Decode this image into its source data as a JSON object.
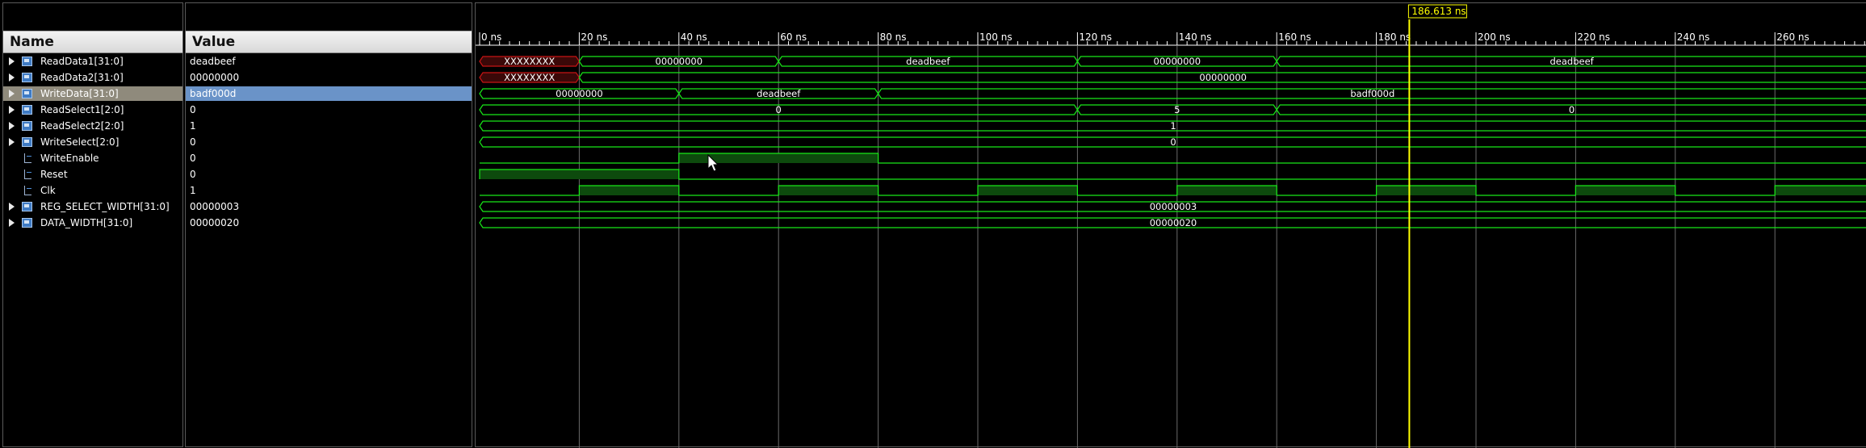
{
  "columns": {
    "name": "Name",
    "value": "Value"
  },
  "cursor": {
    "time_ns": 186.613,
    "label": "186.613 ns",
    "color": "#ffff00"
  },
  "timeline": {
    "start_ns": 0,
    "end_ns": 278.4,
    "major_step_ns": 20,
    "minor_step_ns": 2,
    "tick_labels": [
      "0 ns",
      "20 ns",
      "40 ns",
      "60 ns",
      "80 ns",
      "100 ns",
      "120 ns",
      "140 ns",
      "160 ns",
      "180 ns",
      "200 ns",
      "220 ns",
      "240 ns",
      "260 ns"
    ]
  },
  "colors": {
    "wave": "#18e818",
    "undefined": "#c81414",
    "high_fill": "#0d4a0d",
    "selected_name_bg": "#8f8a7c",
    "selected_value_bg": "#6a93c8"
  },
  "signals": [
    {
      "name": "ReadData1[31:0]",
      "value": "deadbeef",
      "kind": "bus",
      "segments": [
        {
          "start": 0,
          "end": 20,
          "label": "XXXXXXXX",
          "undef": true
        },
        {
          "start": 20,
          "end": 60,
          "label": "00000000"
        },
        {
          "start": 60,
          "end": 120,
          "label": "deadbeef"
        },
        {
          "start": 120,
          "end": 160,
          "label": "00000000"
        },
        {
          "start": 160,
          "end": 300,
          "label": "deadbeef"
        }
      ]
    },
    {
      "name": "ReadData2[31:0]",
      "value": "00000000",
      "kind": "bus",
      "segments": [
        {
          "start": 0,
          "end": 20,
          "label": "XXXXXXXX",
          "undef": true
        },
        {
          "start": 20,
          "end": 300,
          "label": "00000000"
        }
      ]
    },
    {
      "name": "WriteData[31:0]",
      "value": "badf000d",
      "kind": "bus",
      "selected": true,
      "segments": [
        {
          "start": 0,
          "end": 40,
          "label": "00000000"
        },
        {
          "start": 40,
          "end": 80,
          "label": "deadbeef"
        },
        {
          "start": 80,
          "end": 300,
          "label": "badf000d"
        }
      ]
    },
    {
      "name": "ReadSelect1[2:0]",
      "value": "0",
      "kind": "bus",
      "segments": [
        {
          "start": 0,
          "end": 120,
          "label": "0"
        },
        {
          "start": 120,
          "end": 160,
          "label": "5"
        },
        {
          "start": 160,
          "end": 300,
          "label": "0"
        }
      ]
    },
    {
      "name": "ReadSelect2[2:0]",
      "value": "1",
      "kind": "bus",
      "segments": [
        {
          "start": 0,
          "end": 300,
          "label": "1"
        }
      ]
    },
    {
      "name": "WriteSelect[2:0]",
      "value": "0",
      "kind": "bus",
      "segments": [
        {
          "start": 0,
          "end": 300,
          "label": "0"
        }
      ]
    },
    {
      "name": "WriteEnable",
      "value": "0",
      "kind": "bit",
      "high": [
        [
          40,
          80
        ]
      ]
    },
    {
      "name": "Reset",
      "value": "0",
      "kind": "bit",
      "high": [
        [
          0,
          40
        ]
      ]
    },
    {
      "name": "Clk",
      "value": "1",
      "kind": "bit",
      "high": [
        [
          20,
          40
        ],
        [
          60,
          80
        ],
        [
          100,
          120
        ],
        [
          140,
          160
        ],
        [
          180,
          200
        ],
        [
          220,
          240
        ],
        [
          260,
          300
        ]
      ]
    },
    {
      "name": "REG_SELECT_WIDTH[31:0]",
      "value": "00000003",
      "kind": "bus",
      "segments": [
        {
          "start": 0,
          "end": 300,
          "label": "00000003"
        }
      ]
    },
    {
      "name": "DATA_WIDTH[31:0]",
      "value": "00000020",
      "kind": "bus",
      "segments": [
        {
          "start": 0,
          "end": 300,
          "label": "00000020"
        }
      ]
    }
  ]
}
